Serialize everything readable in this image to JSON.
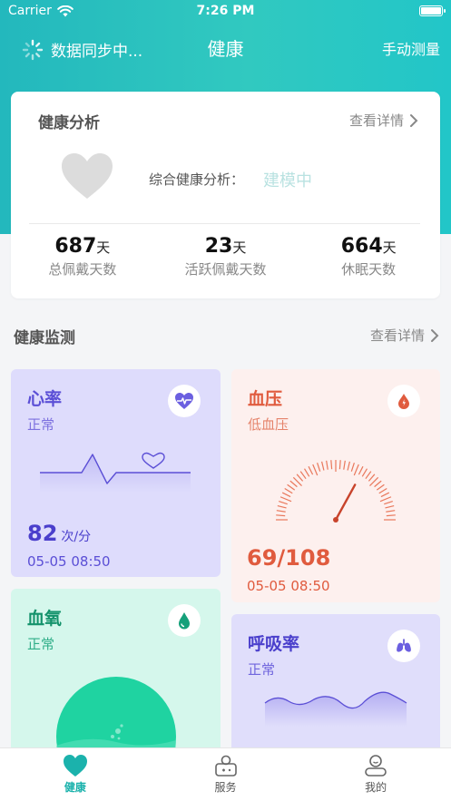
{
  "status_bar": {
    "carrier": "Carrier",
    "time": "7:26 PM"
  },
  "nav": {
    "sync_text": "数据同步中...",
    "title": "健康",
    "measure_label": "手动测量"
  },
  "analysis": {
    "title": "健康分析",
    "more_label": "查看详情",
    "comprehensive_label": "综合健康分析：",
    "comprehensive_value": "建模中",
    "stats": [
      {
        "value": "687",
        "unit": "天",
        "label": "总佩戴天数"
      },
      {
        "value": "23",
        "unit": "天",
        "label": "活跃佩戴天数"
      },
      {
        "value": "664",
        "unit": "天",
        "label": "休眠天数"
      }
    ]
  },
  "monitor": {
    "title": "健康监测",
    "more_label": "查看详情",
    "heart_rate": {
      "title": "心率",
      "status": "正常",
      "value": "82",
      "unit": "次/分",
      "time": "05-05 08:50"
    },
    "blood_pressure": {
      "title": "血压",
      "status": "低血压",
      "value": "69/108",
      "time": "05-05 08:50"
    },
    "blood_oxygen": {
      "title": "血氧",
      "status": "正常"
    },
    "respiration": {
      "title": "呼吸率",
      "status": "正常"
    }
  },
  "tabbar": {
    "items": [
      {
        "label": "健康",
        "active": true
      },
      {
        "label": "服务",
        "active": false
      },
      {
        "label": "我的",
        "active": false
      }
    ]
  },
  "colors": {
    "accent": "#1bb2ac",
    "header": "#2ec3c0",
    "heart_purple": "#5b4fd6",
    "bp_red": "#e05b3e",
    "spo_green": "#14926b"
  },
  "icons": [
    "wifi-icon",
    "battery-icon",
    "sync-spinner-icon",
    "chevron-right-icon",
    "heart-icon",
    "heart-pulse-icon",
    "blood-drop-icon",
    "water-drop-icon",
    "lungs-icon",
    "gauge-icon",
    "health-tab-icon",
    "service-tab-icon",
    "profile-tab-icon"
  ]
}
